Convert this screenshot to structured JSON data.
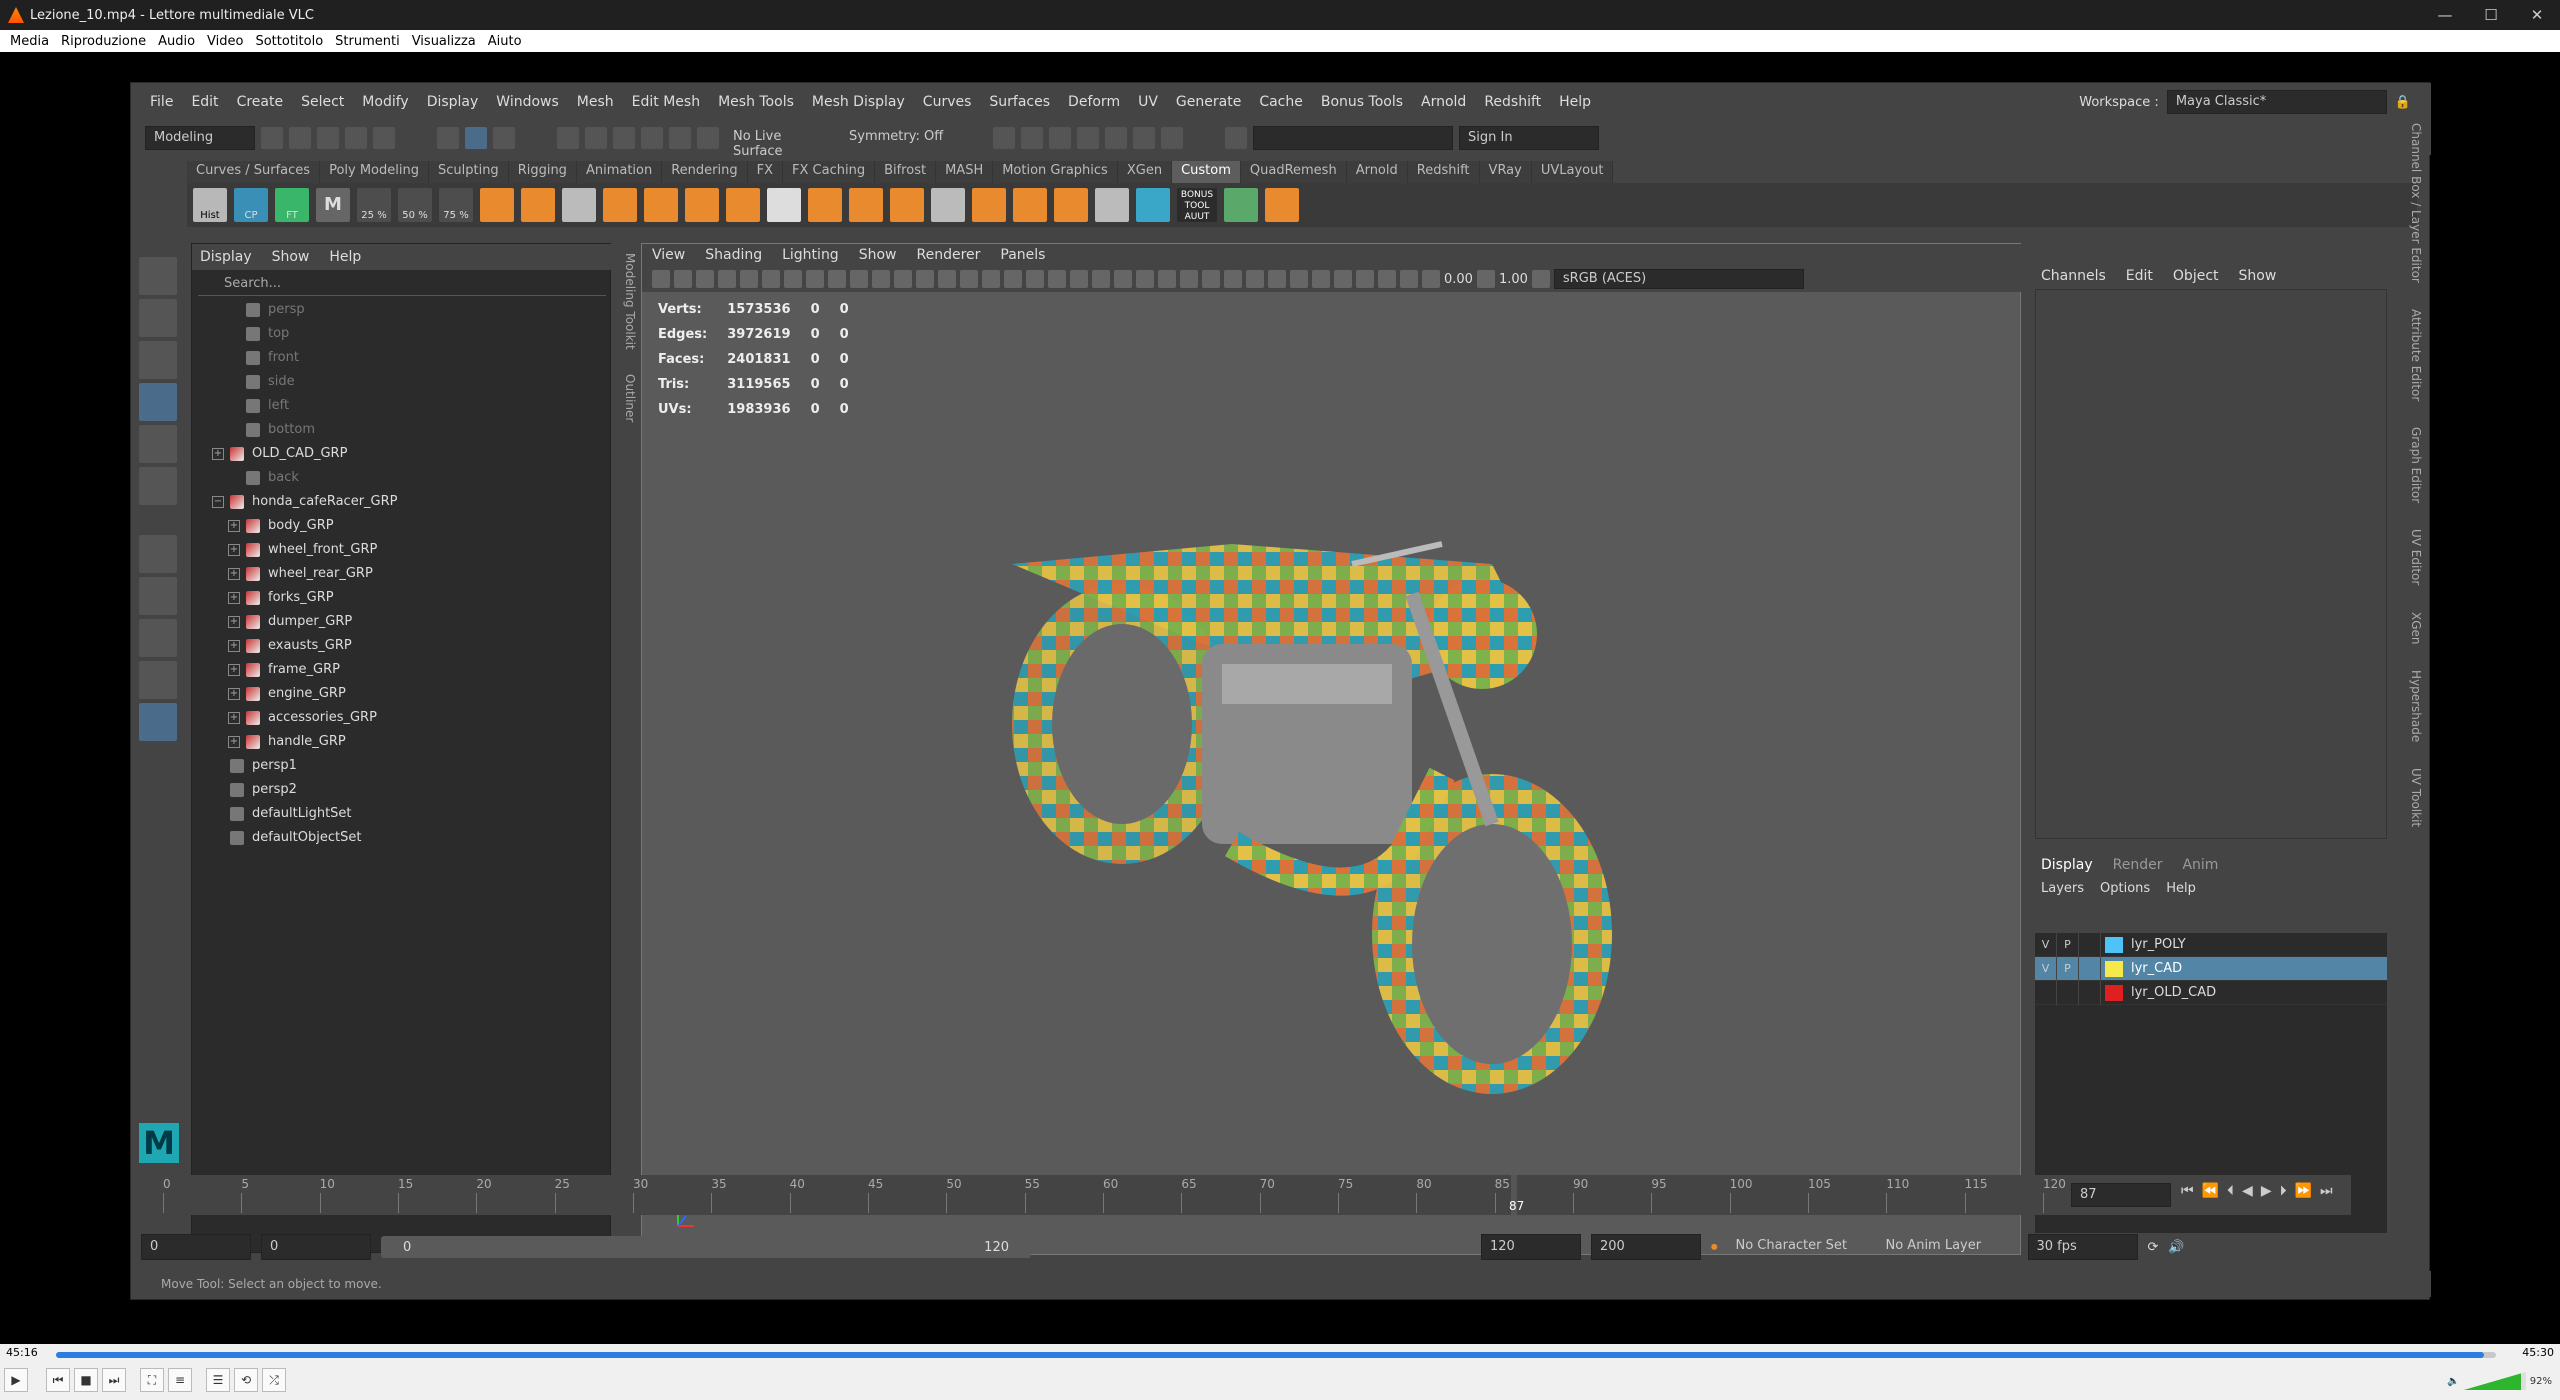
{
  "vlc": {
    "title": "Lezione_10.mp4 - Lettore multimediale VLC",
    "menu": [
      "Media",
      "Riproduzione",
      "Audio",
      "Video",
      "Sottotitolo",
      "Strumenti",
      "Visualizza",
      "Aiuto"
    ],
    "time_elapsed": "45:16",
    "time_total": "45:30",
    "progress": 0.995,
    "volume": "92%"
  },
  "maya": {
    "menubar": [
      "File",
      "Edit",
      "Create",
      "Select",
      "Modify",
      "Display",
      "Windows",
      "Mesh",
      "Edit Mesh",
      "Mesh Tools",
      "Mesh Display",
      "Curves",
      "Surfaces",
      "Deform",
      "UV",
      "Generate",
      "Cache",
      "Bonus Tools",
      "Arnold",
      "Redshift",
      "Help"
    ],
    "workspace_label": "Workspace :",
    "workspace_value": "Maya Classic*",
    "mode": "Modeling",
    "live_surface": "No Live Surface",
    "symmetry": "Symmetry: Off",
    "sign_in": "Sign In",
    "shelf_tabs": [
      "Curves / Surfaces",
      "Poly Modeling",
      "Sculpting",
      "Rigging",
      "Animation",
      "Rendering",
      "FX",
      "FX Caching",
      "Bifrost",
      "MASH",
      "Motion Graphics",
      "XGen",
      "Custom",
      "QuadRemesh",
      "Arnold",
      "Redshift",
      "VRay",
      "UVLayout"
    ],
    "active_shelf": "Custom",
    "shelf_labels": [
      "Hist",
      "CP",
      "FT",
      "25 %",
      "50 %",
      "75 %",
      "BONUS TOOL",
      "AUUT"
    ],
    "outliner": {
      "menu": [
        "Display",
        "Show",
        "Help"
      ],
      "search_placeholder": "Search...",
      "items": [
        {
          "name": "persp",
          "indent": 1,
          "dim": true,
          "icon": "cam"
        },
        {
          "name": "top",
          "indent": 1,
          "dim": true,
          "icon": "cam"
        },
        {
          "name": "front",
          "indent": 1,
          "dim": true,
          "icon": "cam"
        },
        {
          "name": "side",
          "indent": 1,
          "dim": true,
          "icon": "cam"
        },
        {
          "name": "left",
          "indent": 1,
          "dim": true,
          "icon": "cam"
        },
        {
          "name": "bottom",
          "indent": 1,
          "dim": true,
          "icon": "cam"
        },
        {
          "name": "OLD_CAD_GRP",
          "indent": 0,
          "exp": "+",
          "icon": "grp"
        },
        {
          "name": "back",
          "indent": 1,
          "dim": true,
          "icon": "cam"
        },
        {
          "name": "honda_cafeRacer_GRP",
          "indent": 0,
          "exp": "−",
          "icon": "grp"
        },
        {
          "name": "body_GRP",
          "indent": 1,
          "exp": "+",
          "icon": "grp"
        },
        {
          "name": "wheel_front_GRP",
          "indent": 1,
          "exp": "+",
          "icon": "grp"
        },
        {
          "name": "wheel_rear_GRP",
          "indent": 1,
          "exp": "+",
          "icon": "grp"
        },
        {
          "name": "forks_GRP",
          "indent": 1,
          "exp": "+",
          "icon": "grp"
        },
        {
          "name": "dumper_GRP",
          "indent": 1,
          "exp": "+",
          "icon": "grp"
        },
        {
          "name": "exausts_GRP",
          "indent": 1,
          "exp": "+",
          "icon": "grp"
        },
        {
          "name": "frame_GRP",
          "indent": 1,
          "exp": "+",
          "icon": "grp"
        },
        {
          "name": "engine_GRP",
          "indent": 1,
          "exp": "+",
          "icon": "grp"
        },
        {
          "name": "accessories_GRP",
          "indent": 1,
          "exp": "+",
          "icon": "grp"
        },
        {
          "name": "handle_GRP",
          "indent": 1,
          "exp": "+",
          "icon": "grp"
        },
        {
          "name": "persp1",
          "indent": 0,
          "icon": "cam"
        },
        {
          "name": "persp2",
          "indent": 0,
          "icon": "cam"
        },
        {
          "name": "defaultLightSet",
          "indent": 0,
          "icon": "set"
        },
        {
          "name": "defaultObjectSet",
          "indent": 0,
          "icon": "set"
        }
      ],
      "side_tabs": [
        "Modeling Toolkit",
        "Outliner"
      ]
    },
    "viewport": {
      "menu": [
        "View",
        "Shading",
        "Lighting",
        "Show",
        "Renderer",
        "Panels"
      ],
      "exposure": "0.00",
      "gamma": "1.00",
      "color_space": "sRGB (ACES)",
      "hud": [
        {
          "label": "Verts:",
          "v1": "1573536",
          "v2": "0",
          "v3": "0"
        },
        {
          "label": "Edges:",
          "v1": "3972619",
          "v2": "0",
          "v3": "0"
        },
        {
          "label": "Faces:",
          "v1": "2401831",
          "v2": "0",
          "v3": "0"
        },
        {
          "label": "Tris:",
          "v1": "3119565",
          "v2": "0",
          "v3": "0"
        },
        {
          "label": "UVs:",
          "v1": "1983936",
          "v2": "0",
          "v3": "0"
        }
      ]
    },
    "channelbox": {
      "menu": [
        "Channels",
        "Edit",
        "Object",
        "Show"
      ],
      "layer_tabs": [
        "Display",
        "Render",
        "Anim"
      ],
      "layer_menu": [
        "Layers",
        "Options",
        "Help"
      ],
      "layers": [
        {
          "v": "V",
          "p": "P",
          "name": "lyr_POLY",
          "color": "#4fc3f7",
          "selected": false
        },
        {
          "v": "V",
          "p": "P",
          "name": "lyr_CAD",
          "color": "#f5e94c",
          "selected": true
        },
        {
          "v": "",
          "p": "",
          "name": "lyr_OLD_CAD",
          "color": "#e02020",
          "selected": false
        }
      ],
      "side_tabs": [
        "Channel Box / Layer Editor",
        "Attribute Editor",
        "Graph Editor",
        "UV Editor",
        "XGen",
        "Hypershade",
        "UV Toolkit"
      ]
    },
    "timeline": {
      "ticks": [
        "0",
        "5",
        "10",
        "15",
        "20",
        "25",
        "30",
        "35",
        "40",
        "45",
        "50",
        "55",
        "60",
        "65",
        "70",
        "75",
        "80",
        "85",
        "90",
        "95",
        "100",
        "105",
        "110",
        "115",
        "120"
      ],
      "current_frame": "87",
      "current_frame_field": "87"
    },
    "range": {
      "start": "0",
      "playback_start": "0",
      "range_start": "0",
      "range_end": "120",
      "playback_end": "120",
      "end": "200",
      "character_set": "No Character Set",
      "anim_layer": "No Anim Layer",
      "fps": "30 fps"
    },
    "help_line": "Move Tool: Select an object to move."
  }
}
